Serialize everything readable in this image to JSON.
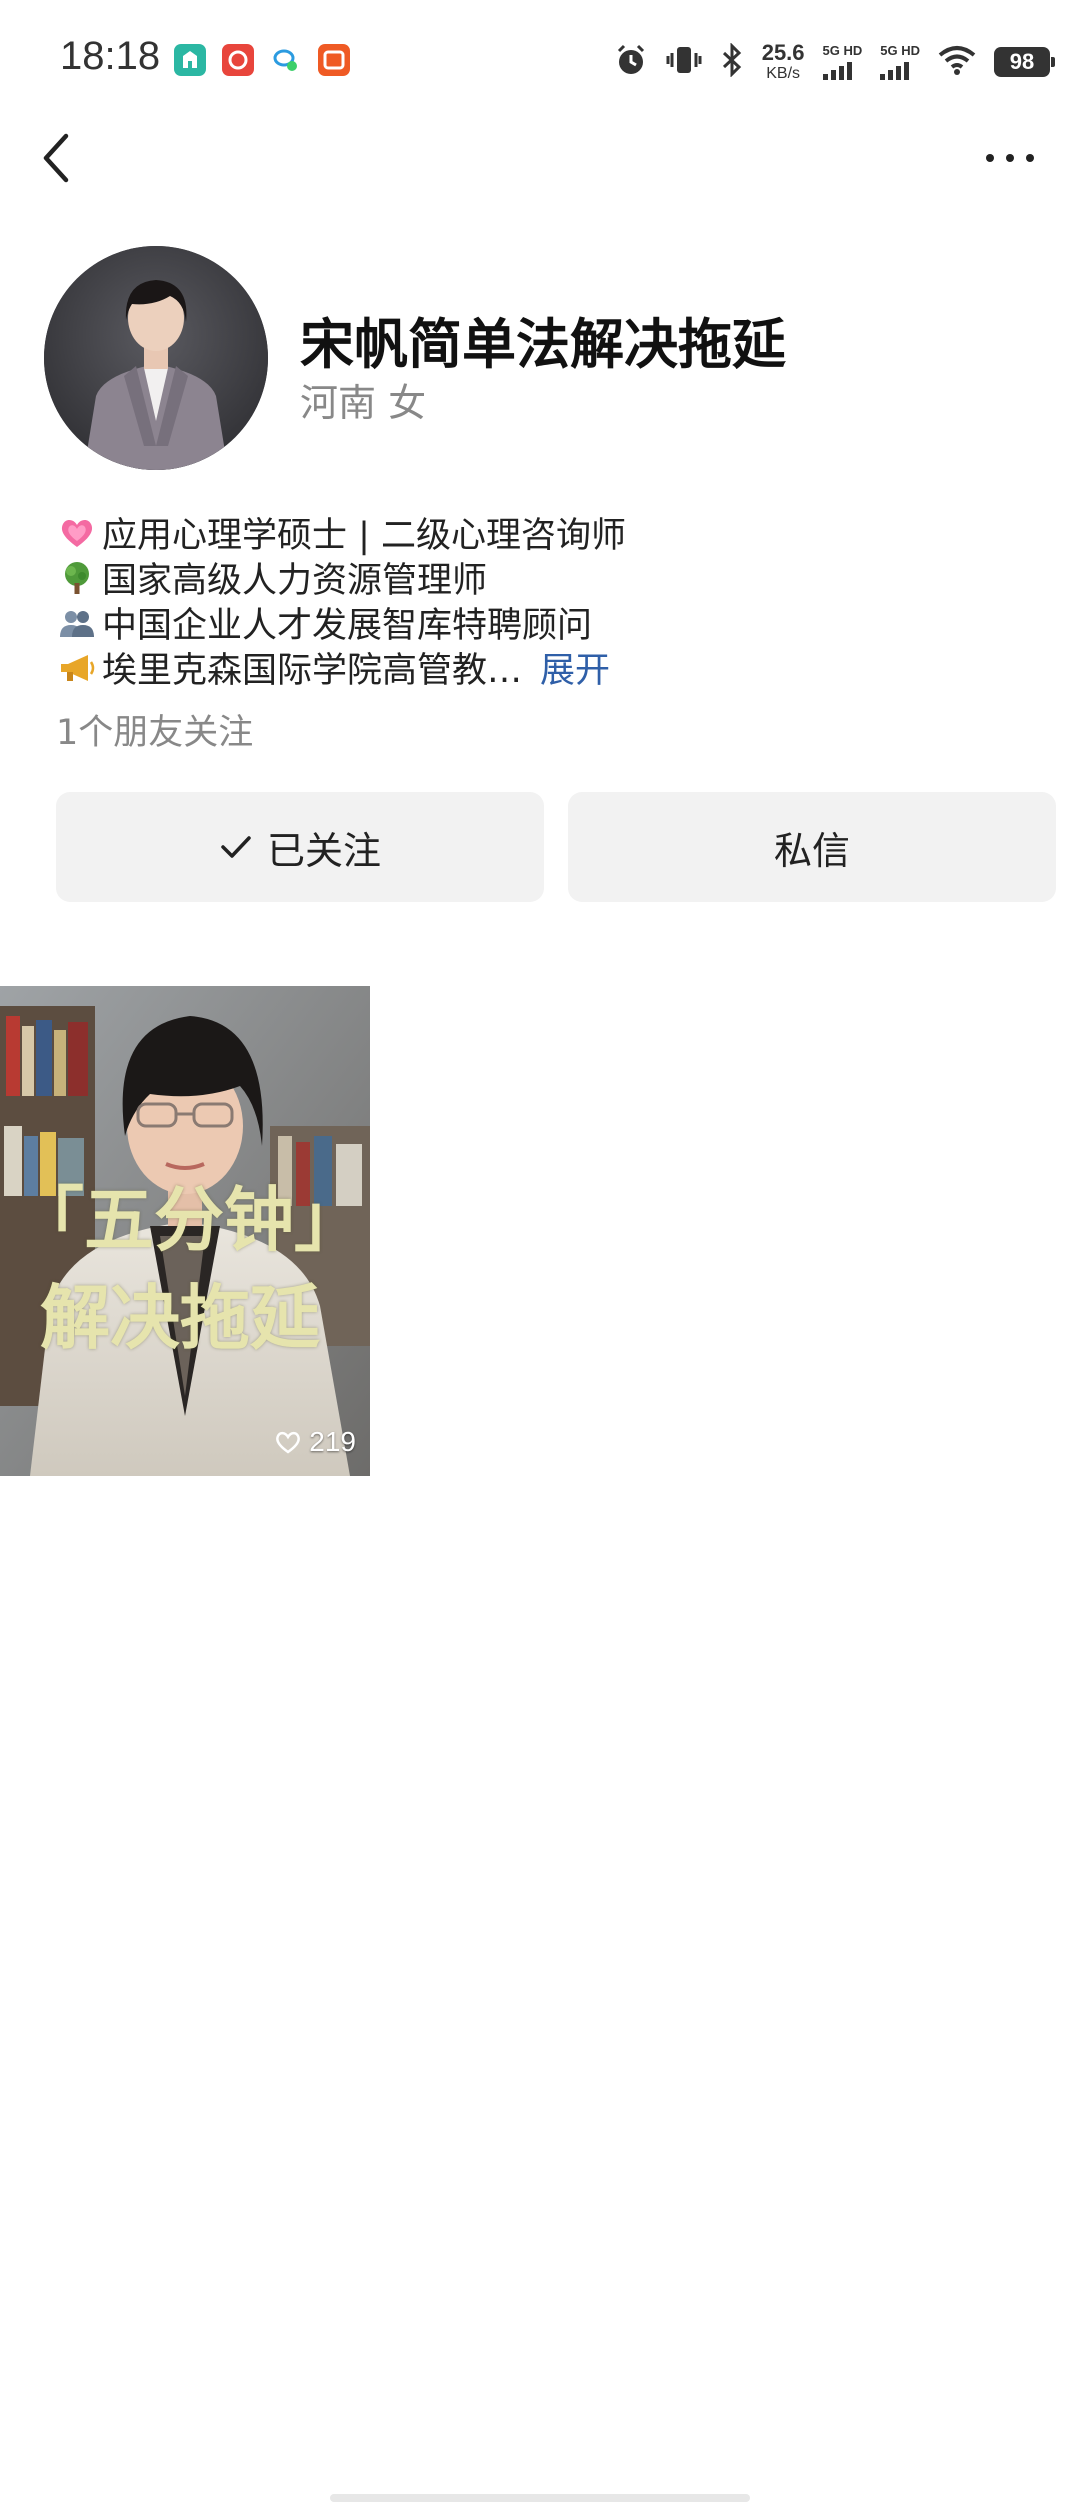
{
  "status_bar": {
    "time": "18:18",
    "net_speed_value": "25.6",
    "net_speed_unit": "KB/s",
    "signal1_label": "5G HD",
    "signal2_label": "5G HD",
    "battery": "98",
    "icons": [
      "mi-home-app-icon",
      "taobao-app-icon",
      "chat-app-icon",
      "taobao-deals-app-icon",
      "alarm-icon",
      "vibrate-icon",
      "bluetooth-icon",
      "wifi-icon"
    ]
  },
  "nav": {
    "back_icon": "chevron-left-icon",
    "more_icon": "more-dots-icon"
  },
  "profile": {
    "name": "宋帆简单法解决拖延",
    "meta": "河南 女",
    "bio": [
      {
        "emoji": "pink-heart",
        "text": "应用心理学硕士 | 二级心理咨询师"
      },
      {
        "emoji": "tree",
        "text": "国家高级人力资源管理师"
      },
      {
        "emoji": "two-people",
        "text": "中国企业人才发展智库特聘顾问"
      },
      {
        "emoji": "megaphone",
        "text": "埃里克森国际学院高管教…"
      }
    ],
    "expand_label": "展开",
    "friends_following": "1个朋友关注"
  },
  "actions": {
    "follow_label": "已关注",
    "message_label": "私信"
  },
  "posts": [
    {
      "title_line1": "「五分钟」",
      "title_line2": "解决拖延",
      "likes": "219"
    }
  ],
  "colors": {
    "accent_link": "#2f5fa8",
    "button_bg": "#f2f2f2",
    "title_overlay": "#e6e4ad"
  }
}
